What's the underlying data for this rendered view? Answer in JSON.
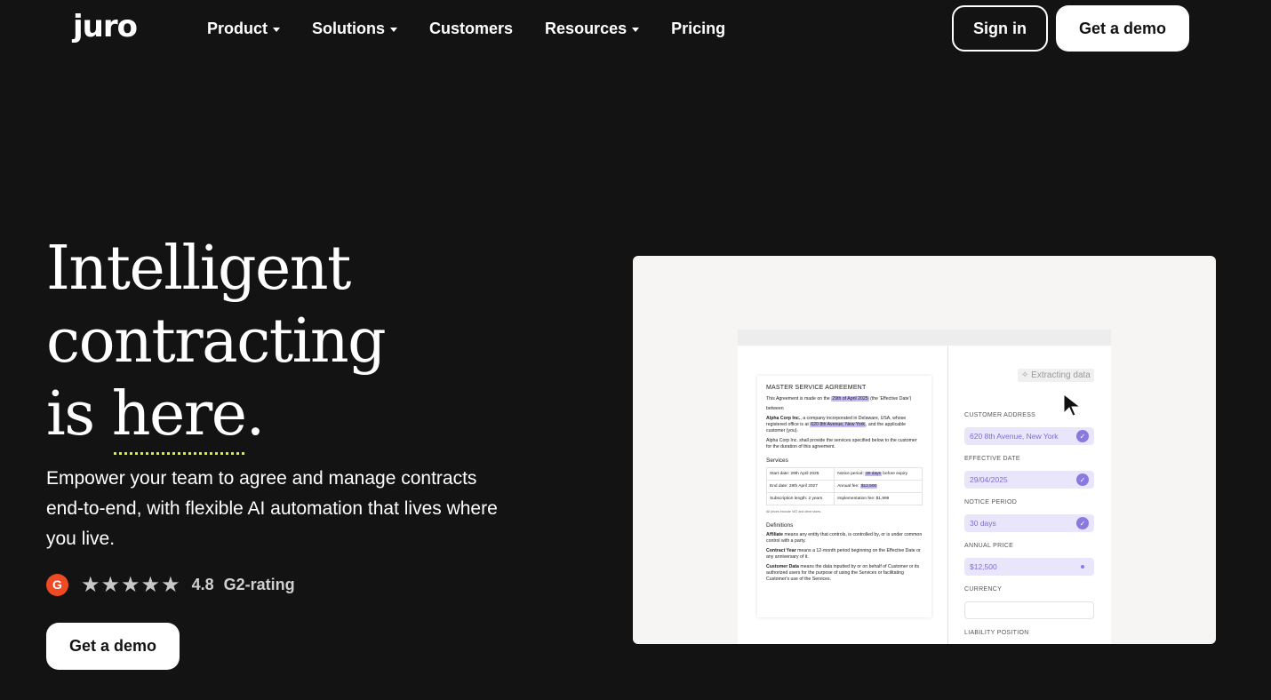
{
  "nav": {
    "logo": "juro",
    "items": [
      {
        "label": "Product",
        "dropdown": true
      },
      {
        "label": "Solutions",
        "dropdown": true
      },
      {
        "label": "Customers",
        "dropdown": false
      },
      {
        "label": "Resources",
        "dropdown": true
      },
      {
        "label": "Pricing",
        "dropdown": false
      }
    ],
    "signin_label": "Sign in",
    "demo_label": "Get a demo"
  },
  "hero": {
    "headline_line1": "Intelligent",
    "headline_line2": "contracting",
    "headline_line3_a": "is ",
    "headline_line3_b": "here",
    "headline_line3_c": ".",
    "subtitle": "Empower your team to agree and manage contracts end-to-end, with flexible AI automation that lives where you live.",
    "rating": {
      "badge": "G",
      "stars": "★★★★★",
      "score": "4.8",
      "label": "G2-rating"
    },
    "cta_label": "Get a demo"
  },
  "mockup": {
    "doc": {
      "title": "MASTER SERVICE AGREEMENT",
      "p1_a": "This Agreement is made on the ",
      "p1_hl": "29th of April 2025",
      "p1_b": " (the 'Effective Date')",
      "between": "between",
      "p2_a": "Alpha Corp Inc.",
      "p2_b": ", a company incorporated in Delaware, USA, whose registered office is at ",
      "p2_hl": "620 8th Avenue, New York",
      "p2_c": ", and the applicable customer (you).",
      "p3": "Alpha Corp Inc. shall provide the services specified below to the customer for the duration of this agreement.",
      "services_heading": "Services",
      "table": {
        "r1c1": "Start date: 29th April 2025",
        "r1c2_a": "Notice period: ",
        "r1c2_hl": "30 days",
        "r1c2_b": " before expiry",
        "r2c1": "End date: 28th April 2027",
        "r2c2_a": "Annual fee: ",
        "r2c2_hl": "$12,500",
        "r3c1": "Subscription length: 2 years",
        "r3c2": "Implementation fee: $1,999"
      },
      "prices_note": "All prices exclude VAT and other taxes.",
      "definitions_heading": "Definitions",
      "def1_term": "Affiliate",
      "def1_text": " means any entity that controls, is controlled by, or is under common control with a party.",
      "def2_term": "Contract Year",
      "def2_text": " means a 12-month period beginning on the Effective Date or any anniversary of it.",
      "def3_term": "Customer Data",
      "def3_text": " means the data inputted by or on behalf of Customer or its authorized users for the purpose of using the Services or facilitating Customer's use of the Services."
    },
    "side": {
      "extract_label": "✧ Extracting data",
      "fields": [
        {
          "label": "CUSTOMER ADDRESS",
          "value": "620 8th Avenue, New York",
          "state": "checked"
        },
        {
          "label": "EFFECTIVE DATE",
          "value": "29/04/2025",
          "state": "checked"
        },
        {
          "label": "NOTICE PERIOD",
          "value": "30 days",
          "state": "checked"
        },
        {
          "label": "ANNUAL PRICE",
          "value": "$12,500",
          "state": "loading"
        },
        {
          "label": "CURRENCY",
          "value": "",
          "state": "empty"
        },
        {
          "label": "LIABILITY POSITION",
          "value": "",
          "state": "hidden"
        }
      ]
    }
  },
  "colors": {
    "background": "#141313",
    "highlight": "#c6b9f4",
    "accent_purple": "#8c79e0",
    "underline_accent": "#d4e95a",
    "g2_red": "#ef4a23"
  }
}
